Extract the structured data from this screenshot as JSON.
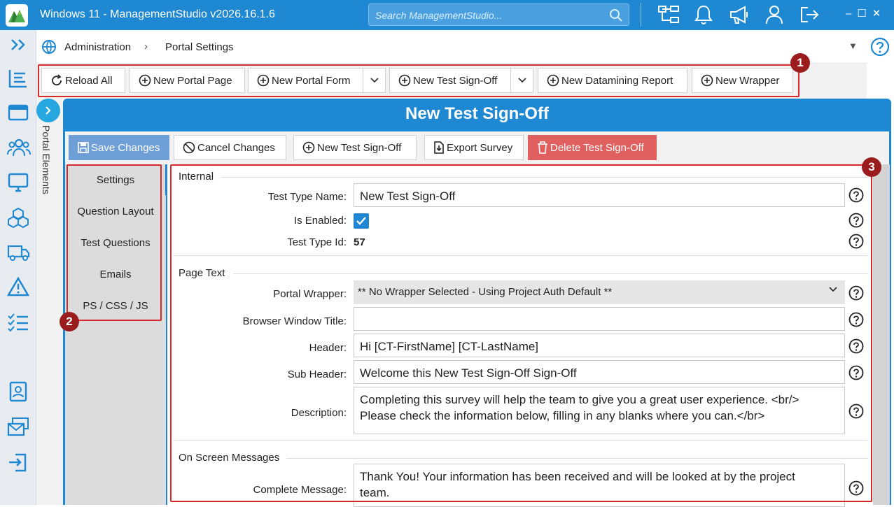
{
  "app": {
    "title": "Windows 11 - ManagementStudio v2026.16.1.6",
    "search_placeholder": "Search ManagementStudio..."
  },
  "breadcrumb": {
    "root": "Administration",
    "page": "Portal Settings"
  },
  "toolbar": {
    "reload_all": "Reload All",
    "new_portal_page": "New Portal Page",
    "new_portal_form": "New Portal Form",
    "new_test_signoff": "New Test Sign-Off",
    "new_datamining_report": "New Datamining Report",
    "new_wrapper": "New Wrapper"
  },
  "sidetab": {
    "label": "Portal Elements"
  },
  "panel": {
    "title": "New Test Sign-Off"
  },
  "actions": {
    "save": "Save Changes",
    "cancel": "Cancel Changes",
    "new": "New Test Sign-Off",
    "export": "Export Survey",
    "delete": "Delete Test Sign-Off"
  },
  "nav": {
    "items": [
      "Settings",
      "Question Layout",
      "Test Questions",
      "Emails",
      "PS / CSS / JS"
    ]
  },
  "form": {
    "internal": {
      "section": "Internal",
      "test_type_name_label": "Test Type Name:",
      "test_type_name": "New Test Sign-Off",
      "is_enabled_label": "Is Enabled:",
      "is_enabled": true,
      "test_type_id_label": "Test Type Id:",
      "test_type_id": "57"
    },
    "page_text": {
      "section": "Page Text",
      "portal_wrapper_label": "Portal Wrapper:",
      "portal_wrapper": "** No Wrapper Selected - Using Project Auth Default **",
      "browser_title_label": "Browser Window Title:",
      "browser_title": "",
      "header_label": "Header:",
      "header": "Hi [CT-FirstName] [CT-LastName]",
      "subheader_label": "Sub Header:",
      "subheader": "Welcome this New Test Sign-Off Sign-Off",
      "description_label": "Description:",
      "description_line1": "Completing this survey will help the team to give you a great user experience. <br/>",
      "description_line2": "Please check the information below, filling in any blanks where you can.</br>"
    },
    "messages": {
      "section": "On Screen Messages",
      "complete_label": "Complete Message:",
      "complete_line1": "Thank You! Your information has been received and will be looked at by the project",
      "complete_line2": "team."
    }
  },
  "callouts": [
    "1",
    "2",
    "3"
  ],
  "colors": {
    "titlebar": "#1e88d2",
    "accent": "#27a7e0",
    "callout_border": "#d42a2a",
    "callout_badge": "#9a1c1c",
    "save_button": "#6e9fd7",
    "delete_button": "#e06060"
  }
}
